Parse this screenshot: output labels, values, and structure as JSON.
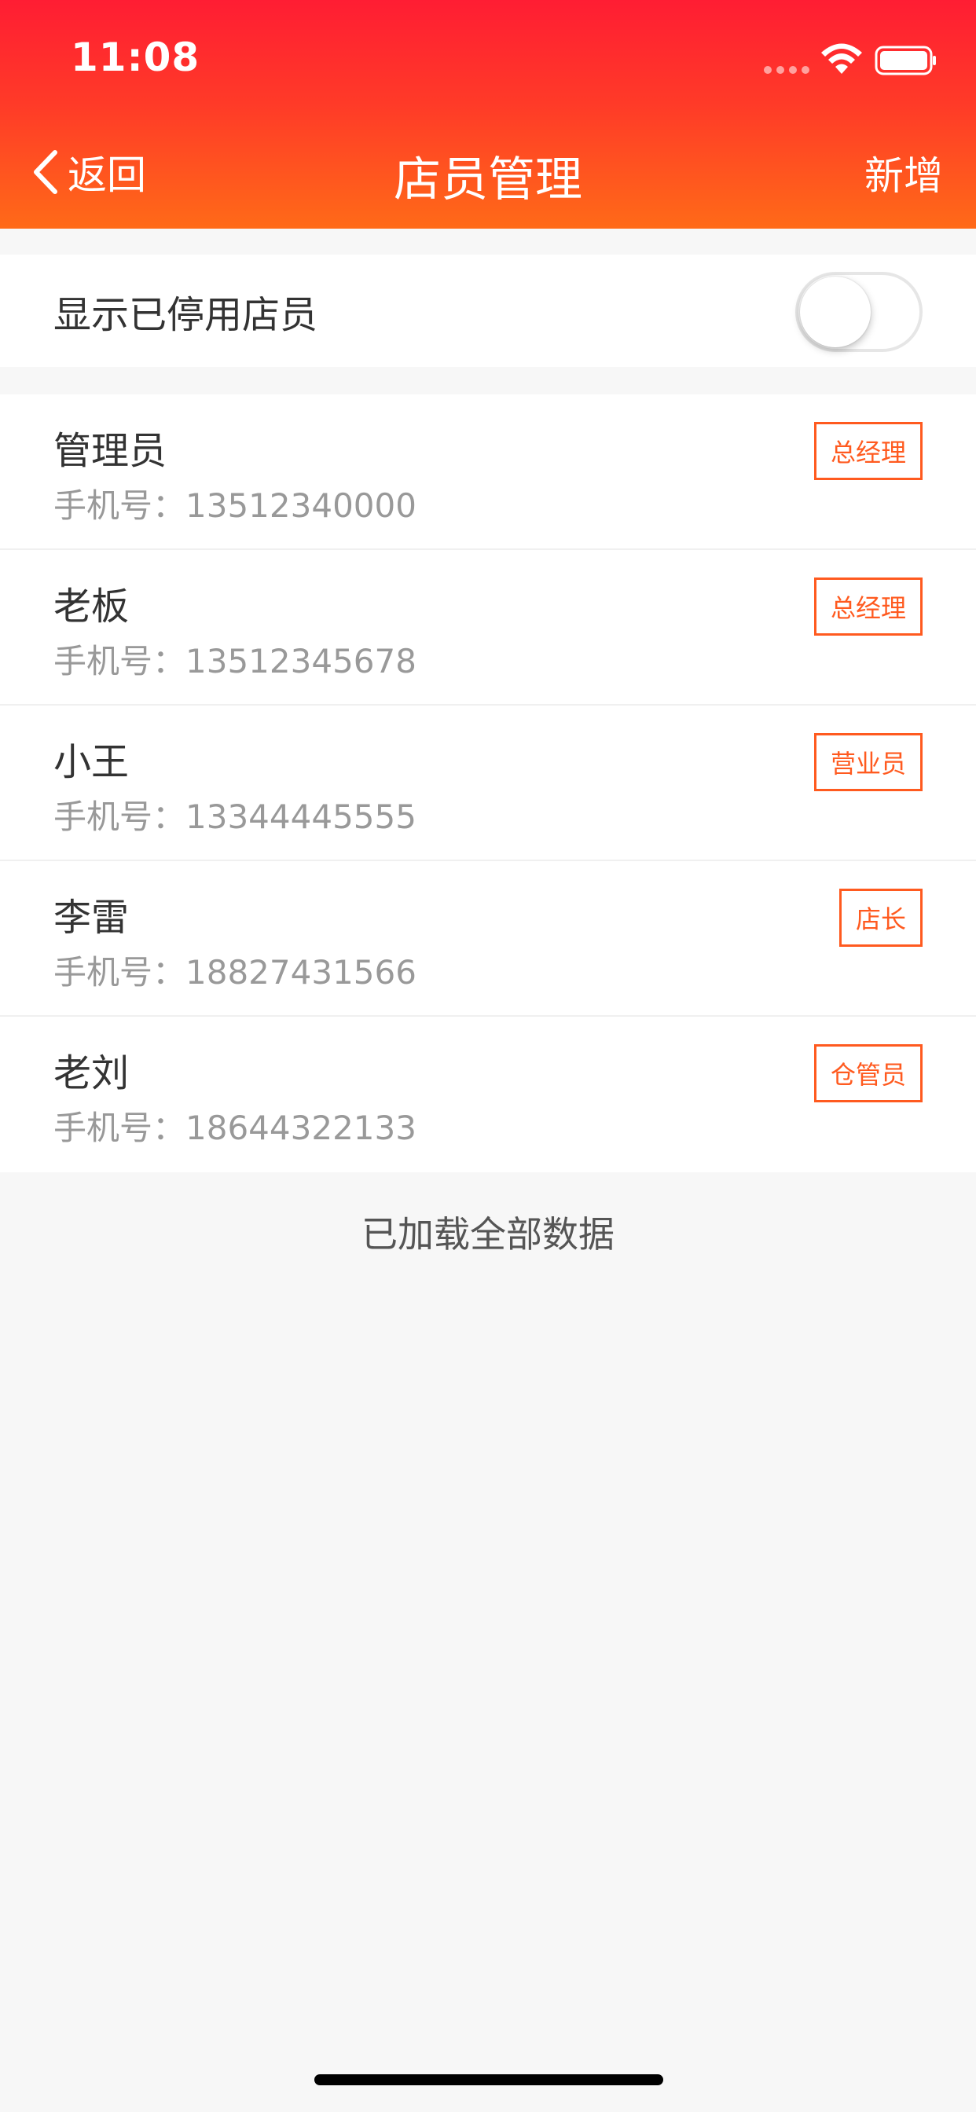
{
  "status_bar": {
    "time": "11:08"
  },
  "nav": {
    "back_label": "返回",
    "title": "店员管理",
    "add_label": "新增"
  },
  "filter": {
    "show_disabled_label": "显示已停用店员",
    "show_disabled_on": false
  },
  "phone_label": "手机号：",
  "staff": [
    {
      "name": "管理员",
      "phone": "13512340000",
      "role": "总经理"
    },
    {
      "name": "老板",
      "phone": "13512345678",
      "role": "总经理"
    },
    {
      "name": "小王",
      "phone": "13344445555",
      "role": "营业员"
    },
    {
      "name": "李雷",
      "phone": "18827431566",
      "role": "店长"
    },
    {
      "name": "老刘",
      "phone": "18644322133",
      "role": "仓管员"
    }
  ],
  "footer": {
    "loaded_text": "已加载全部数据"
  },
  "colors": {
    "header_top": "#ff1d33",
    "header_bottom": "#ff6a18",
    "badge": "#ff5a1f"
  }
}
